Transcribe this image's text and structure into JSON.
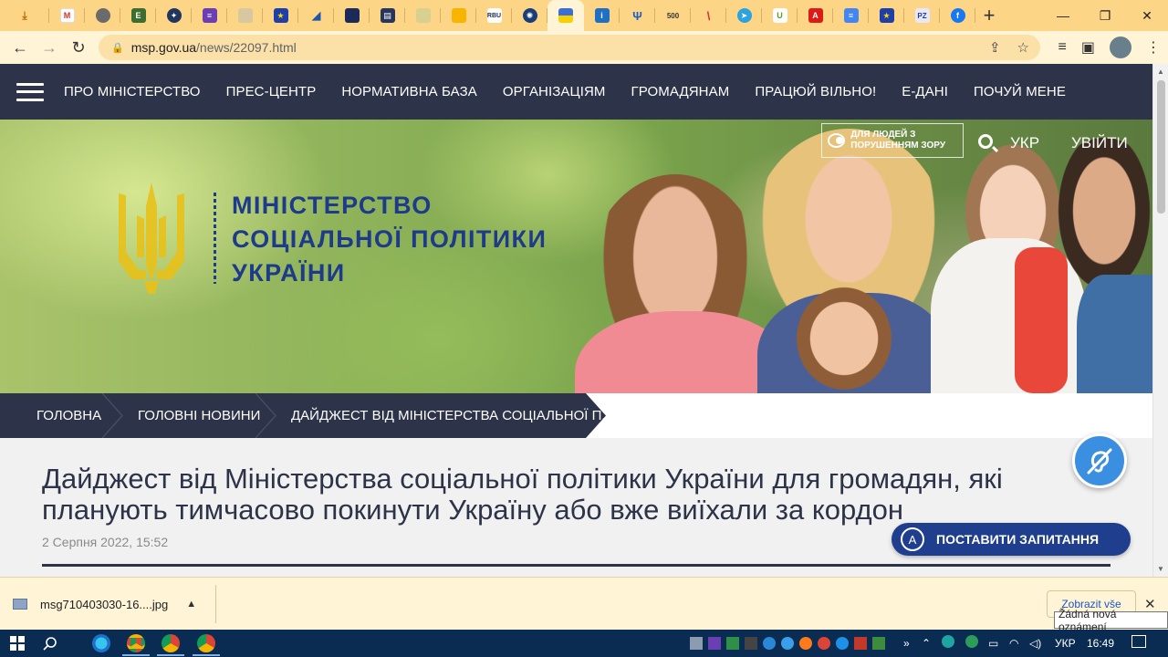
{
  "browser": {
    "tab_favicons": [
      "download",
      "gmail",
      "globe",
      "e-logo",
      "nato",
      "list",
      "doc",
      "eu",
      "chart",
      "dark",
      "stats",
      "yellow",
      "flag-color",
      "rbu",
      "cd",
      "ukraine-active",
      "i-logo",
      "trident",
      "500",
      "v-logo",
      "telegram",
      "u-logo",
      "angular",
      "docs",
      "eu2",
      "pz",
      "facebook"
    ],
    "url_host": "msp.gov.ua",
    "url_path": "/news/22097.html"
  },
  "site": {
    "nav": [
      "ПРО МІНІСТЕРСТВО",
      "ПРЕС-ЦЕНТР",
      "НОРМАТИВНА БАЗА",
      "ОРГАНІЗАЦІЯМ",
      "ГРОМАДЯНАМ",
      "ПРАЦЮЙ ВІЛЬНО!",
      "Е-ДАНІ",
      "ПОЧУЙ МЕНЕ"
    ],
    "ministry_lines": [
      "МІНІСТЕРСТВО",
      "СОЦІАЛЬНОЇ ПОЛІТИКИ",
      "УКРАЇНИ"
    ],
    "a11y_label": "ДЛЯ ЛЮДЕЙ З ПОРУШЕННЯМ ЗОРУ",
    "lang": "УКР",
    "login": "УВІЙТИ"
  },
  "breadcrumbs": [
    "ГОЛОВНА",
    "ГОЛОВНІ НОВИНИ",
    "ДАЙДЖЕСТ ВІД МІНІСТЕРСТВА СОЦІАЛЬНОЇ П..."
  ],
  "article": {
    "title": "Дайджест від Міністерства соціальної політики України для громадян, які планують тимчасово покинути Україну або вже виїхали за кордон",
    "date": "2 Серпня 2022, 15:52"
  },
  "ask_button": {
    "icon_letter": "A",
    "label": "ПОСТАВИТИ ЗАПИТАННЯ"
  },
  "downloads": {
    "file_name": "msg710403030-16....jpg",
    "show_all": "Zobrazit vše",
    "tooltip": "Žádná nová oznámení"
  },
  "taskbar": {
    "lang": "УКР",
    "time": "16:49"
  },
  "colors": {
    "tab_strip": "#fcd586",
    "site_nav": "#2d3348",
    "ministry_blue": "#1e3a8a",
    "ask_button": "#1f3f8e"
  }
}
